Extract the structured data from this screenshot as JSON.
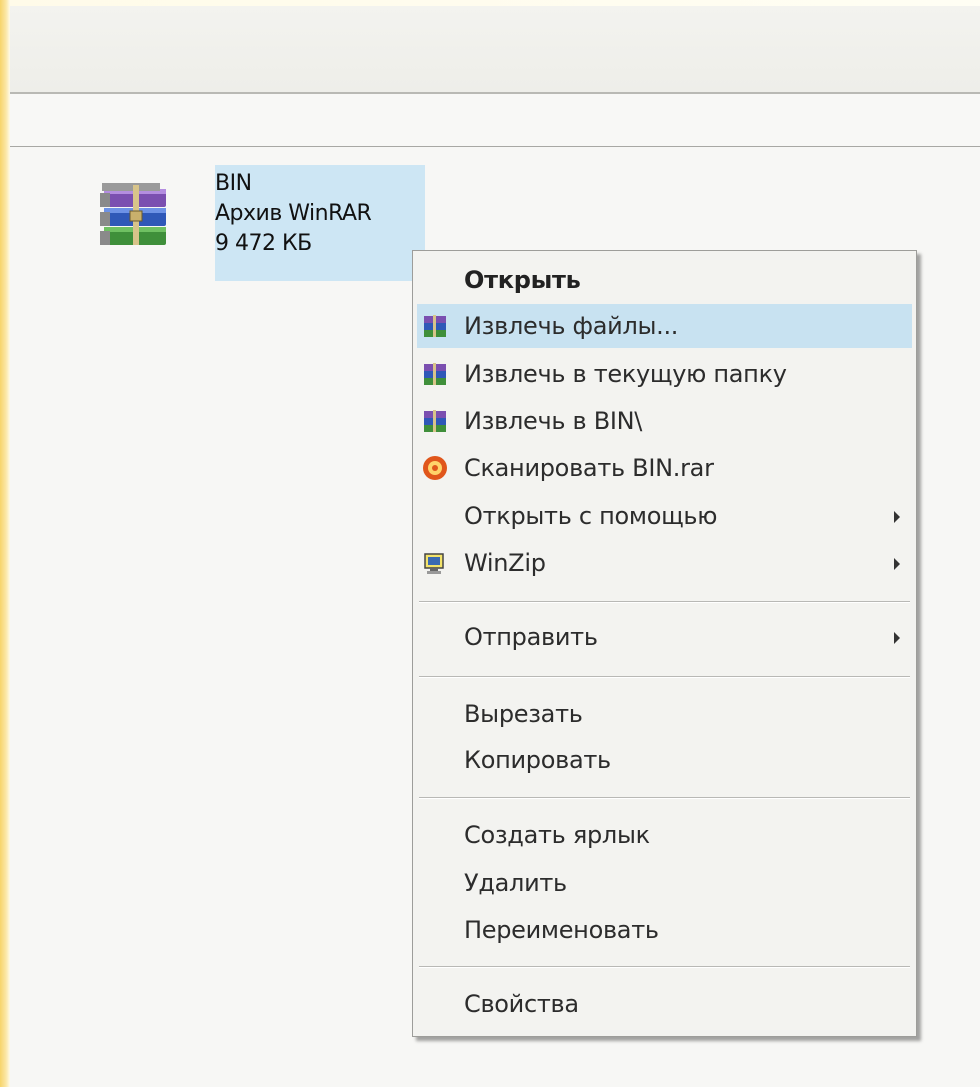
{
  "file": {
    "name": "BIN",
    "type": "Архив WinRAR",
    "size": "9 472 КБ",
    "icon": "winrar-archive-icon"
  },
  "context_menu": {
    "items": [
      {
        "label": "Открыть",
        "bold": true
      },
      {
        "label": "Извлечь файлы...",
        "icon": "winrar-icon",
        "highlighted": true
      },
      {
        "label": "Извлечь в текущую папку",
        "icon": "winrar-icon"
      },
      {
        "label": "Извлечь в BIN\\",
        "icon": "winrar-icon"
      },
      {
        "label": "Сканировать BIN.rar",
        "icon": "antivirus-icon"
      },
      {
        "label": "Открыть с помощью",
        "submenu": true
      },
      {
        "label": "WinZip",
        "icon": "winzip-icon",
        "submenu": true
      },
      {
        "label": "Отправить",
        "submenu": true
      },
      {
        "label": "Вырезать"
      },
      {
        "label": "Копировать"
      },
      {
        "label": "Создать ярлык"
      },
      {
        "label": "Удалить"
      },
      {
        "label": "Переименовать"
      },
      {
        "label": "Свойства"
      }
    ]
  },
  "colors": {
    "selection": "#cde6f4",
    "menu_highlight": "#c8e2f1",
    "menu_background": "#f3f3f0"
  }
}
